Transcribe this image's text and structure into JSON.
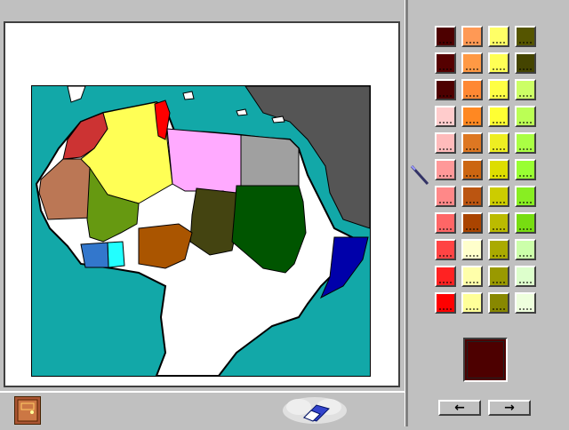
{
  "app": {
    "exit_icon": "door-exit-icon",
    "eraser_icon": "eraser-icon",
    "pen_icon": "pen-icon"
  },
  "map": {
    "region": "Northern Africa",
    "colors": {
      "ocean": "#12a8a8",
      "western_sahara_morocco": "#cc3333",
      "algeria": "#ffff55",
      "tunisia": "#ff0000",
      "libya": "#ffaaff",
      "egypt": "#a0a0a0",
      "middle_east": "#555555",
      "mauritania": "#bb7755",
      "mali": "#669911",
      "niger_blank": "#ffffff",
      "chad": "#444411",
      "sudan": "#005500",
      "somalia": "#0000aa",
      "nigeria": "#aa5500",
      "ghana": "#22ffff",
      "ivory_coast": "#3377cc",
      "land_blank": "#ffffff"
    }
  },
  "palette": {
    "columns": [
      [
        "#4d0000",
        "#550000",
        "#4d0000",
        "#ffcccc",
        "#ffbbbb",
        "#ff9999",
        "#ff8888",
        "#ff6666",
        "#ff4444",
        "#ff2222",
        "#ff0000"
      ],
      [
        "#ff9955",
        "#ff9944",
        "#ff8833",
        "#ff8822",
        "#dd7722",
        "#cc6611",
        "#bb5511",
        "#aa4400",
        "#ffffcc",
        "#ffffaa",
        "#ffff99"
      ],
      [
        "#ffff66",
        "#ffff55",
        "#ffff44",
        "#ffff33",
        "#eeee22",
        "#dddd00",
        "#cccc00",
        "#bbbb00",
        "#aaaa00",
        "#999900",
        "#888800"
      ],
      [
        "#555500",
        "#444400",
        "#ccff66",
        "#bbff55",
        "#aaff44",
        "#99ff33",
        "#88ee22",
        "#77dd11",
        "#ccffaa",
        "#ddffcc",
        "#eeffdd"
      ]
    ],
    "selected": "#4d0000"
  },
  "nav": {
    "prev_label": "←",
    "next_label": "→"
  }
}
